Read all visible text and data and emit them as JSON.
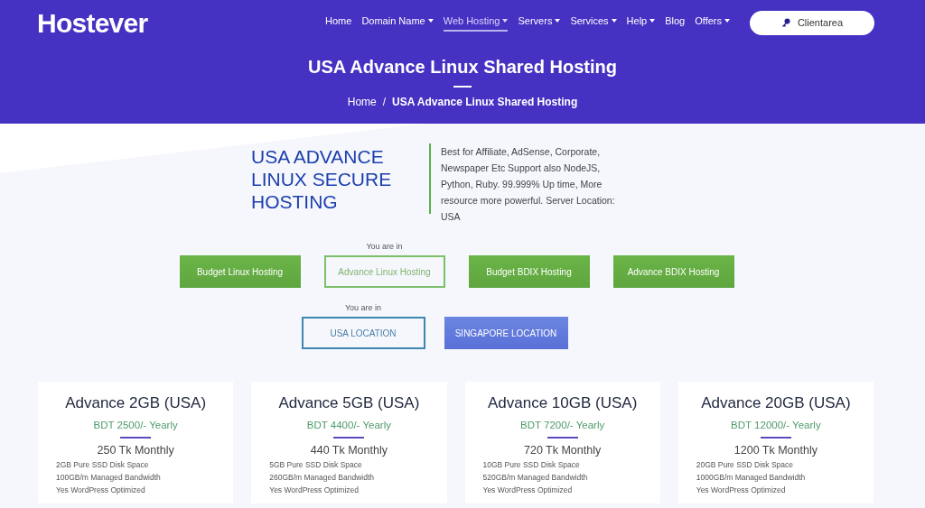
{
  "logo": "Hostever",
  "nav": [
    {
      "label": "Home",
      "dropdown": false,
      "selected": false
    },
    {
      "label": "Domain Name",
      "dropdown": true,
      "selected": false
    },
    {
      "label": "Web Hosting",
      "dropdown": true,
      "selected": true
    },
    {
      "label": "Servers",
      "dropdown": true,
      "selected": false
    },
    {
      "label": "Services",
      "dropdown": true,
      "selected": false
    },
    {
      "label": "Help",
      "dropdown": true,
      "selected": false
    },
    {
      "label": "Blog",
      "dropdown": false,
      "selected": false
    },
    {
      "label": "Offers",
      "dropdown": true,
      "selected": false
    }
  ],
  "client_button": "Clientarea",
  "page_title": "USA Advance Linux Shared Hosting",
  "breadcrumb": [
    "Home",
    "/",
    "USA Advance Linux Shared Hosting"
  ],
  "intro": {
    "heading": "USA ADVANCE LINUX SECURE HOSTING",
    "description": "Best for Affiliate, AdSense, Corporate, Newspaper Etc Support also NodeJS, Python, Ruby. 99.999% Up time, More resource more powerful. Server Location: USA"
  },
  "plan_types_note": "You are in",
  "plan_types": [
    {
      "label": "Budget Linux Hosting",
      "selected": false
    },
    {
      "label": "Advance Linux Hosting",
      "selected": true
    },
    {
      "label": "Budget BDIX Hosting",
      "selected": false
    },
    {
      "label": "Advance BDIX Hosting",
      "selected": false
    }
  ],
  "locations_note": "You are in",
  "locations": [
    {
      "label": "USA LOCATION",
      "selected": true
    },
    {
      "label": "SINGAPORE LOCATION",
      "selected": false
    }
  ],
  "plans": [
    {
      "name": "Advance 2GB (USA)",
      "yearly": "BDT 2500/- Yearly",
      "monthly": "250 Tk Monthly",
      "features": [
        "2GB Pure SSD Disk Space",
        "100GB/m Managed Bandwidth",
        "Yes WordPress Optimized"
      ]
    },
    {
      "name": "Advance 5GB (USA)",
      "yearly": "BDT 4400/- Yearly",
      "monthly": "440 Tk Monthly",
      "features": [
        "5GB Pure SSD Disk Space",
        "260GB/m Managed Bandwidth",
        "Yes WordPress Optimized"
      ]
    },
    {
      "name": "Advance 10GB (USA)",
      "yearly": "BDT 7200/- Yearly",
      "monthly": "720 Tk Monthly",
      "features": [
        "10GB Pure SSD Disk Space",
        "520GB/m Managed Bandwidth",
        "Yes WordPress Optimized"
      ]
    },
    {
      "name": "Advance 20GB (USA)",
      "yearly": "BDT 12000/- Yearly",
      "monthly": "1200 Tk Monthly",
      "features": [
        "20GB Pure SSD Disk Space",
        "1000GB/m Managed Bandwidth",
        "Yes WordPress Optimized"
      ]
    }
  ]
}
